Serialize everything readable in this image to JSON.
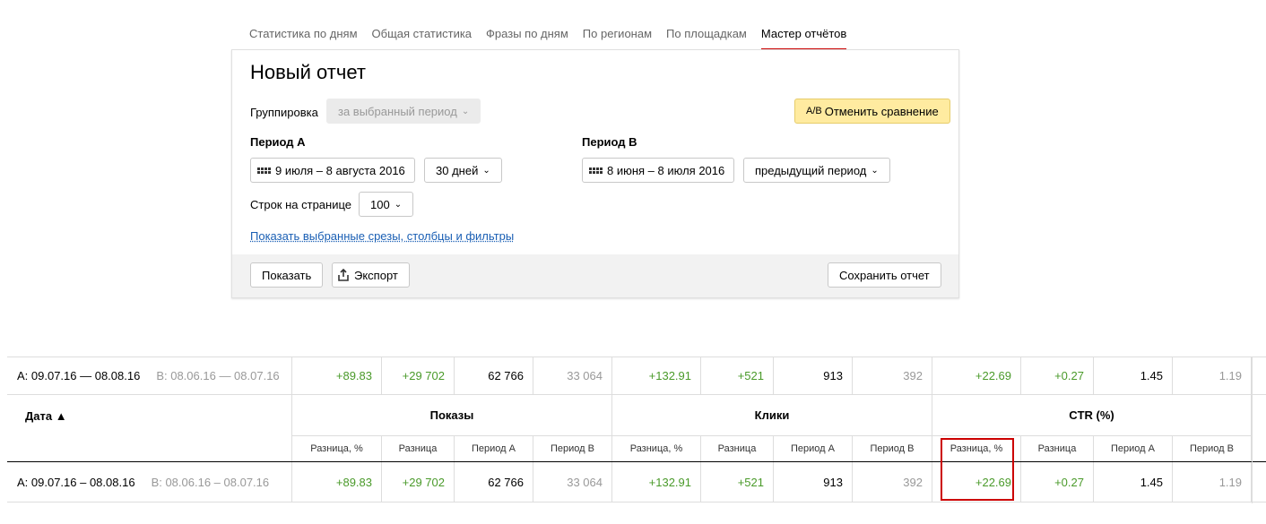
{
  "tabs": [
    {
      "label": "Статистика по дням",
      "active": false
    },
    {
      "label": "Общая статистика",
      "active": false
    },
    {
      "label": "Фразы по дням",
      "active": false
    },
    {
      "label": "По регионам",
      "active": false
    },
    {
      "label": "По площадкам",
      "active": false
    },
    {
      "label": "Мастер отчётов",
      "active": true
    }
  ],
  "report": {
    "title": "Новый отчет",
    "grouping_label": "Группировка",
    "grouping_value": "за выбранный период",
    "cancel_compare": "Отменить сравнение",
    "period_a_label": "Период А",
    "period_a_range": "9 июля – 8 августа 2016",
    "period_a_preset": "30 дней",
    "period_b_label": "Период В",
    "period_b_range": "8 июня – 8 июля 2016",
    "period_b_preset": "предыдущий период",
    "rows_label": "Строк на странице",
    "rows_value": "100",
    "show_slices_link": "Показать выбранные срезы, столбцы и фильтры",
    "show_button": "Показать",
    "export_button": "Экспорт",
    "save_button": "Сохранить отчет"
  },
  "table": {
    "summary": {
      "period_a": "A: 09.07.16 — 08.08.16",
      "period_b": "B: 08.06.16 — 08.07.16",
      "values": [
        "+89.83",
        "+29 702",
        "62 766",
        "33 064",
        "+132.91",
        "+521",
        "913",
        "392",
        "+22.69",
        "+0.27",
        "1.45",
        "1.19"
      ]
    },
    "date_header": "Дата ▲",
    "groups": [
      "Показы",
      "Клики",
      "CTR (%)"
    ],
    "subheaders": [
      "Разница, %",
      "Разница",
      "Период А",
      "Период В"
    ],
    "row": {
      "period_a": "A: 09.07.16 – 08.08.16",
      "period_b": "B: 08.06.16 – 08.07.16",
      "values": [
        "+89.83",
        "+29 702",
        "62 766",
        "33 064",
        "+132.91",
        "+521",
        "913",
        "392",
        "+22.69",
        "+0.27",
        "1.45",
        "1.19"
      ]
    }
  },
  "colors": {
    "positive": "#4a9a2a",
    "accent": "#cc0000",
    "highlight_button": "#ffeba0"
  }
}
